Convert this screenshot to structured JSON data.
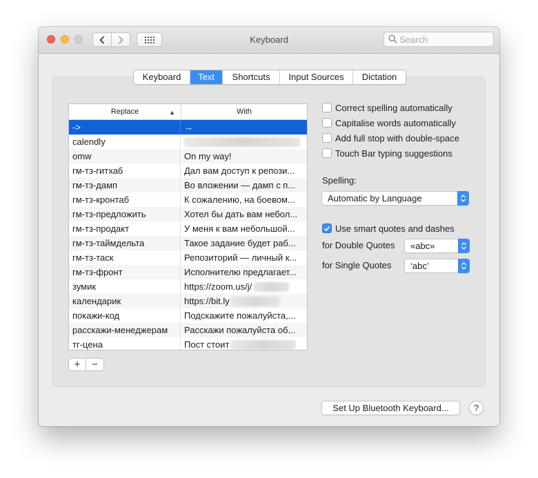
{
  "window": {
    "title": "Keyboard"
  },
  "search": {
    "placeholder": "Search"
  },
  "tabs": [
    {
      "label": "Keyboard",
      "active": false
    },
    {
      "label": "Text",
      "active": true
    },
    {
      "label": "Shortcuts",
      "active": false
    },
    {
      "label": "Input Sources",
      "active": false
    },
    {
      "label": "Dictation",
      "active": false
    }
  ],
  "table": {
    "headers": {
      "replace": "Replace",
      "with": "With"
    },
    "sort": "ascending",
    "rows": [
      {
        "replace": "->",
        "with": "→",
        "selected": true
      },
      {
        "replace": "calendly",
        "with": ""
      },
      {
        "replace": "omw",
        "with": "On my way!"
      },
      {
        "replace": "гм-тз-гитхаб",
        "with": "Дал вам доступ к репози..."
      },
      {
        "replace": "гм-тз-дамп",
        "with": "Во вложении — дамп с п..."
      },
      {
        "replace": "гм-тз-кронтаб",
        "with": "К сожалению, на боевом..."
      },
      {
        "replace": "гм-тз-предложить",
        "with": "Хотел бы дать вам небол..."
      },
      {
        "replace": "гм-тз-продакт",
        "with": "У меня к вам небольшой..."
      },
      {
        "replace": "гм-тз-таймдельта",
        "with": "Такое задание будет раб..."
      },
      {
        "replace": "гм-тз-таск",
        "with": "Репозиторий — личный к..."
      },
      {
        "replace": "гм-тз-фронт",
        "with": "Исполнителю предлагает..."
      },
      {
        "replace": "зумик",
        "with": "https://zoom.us/j/"
      },
      {
        "replace": "календарик",
        "with": "https://bit.ly"
      },
      {
        "replace": "покажи-код",
        "with": "Подскажите пожалуйста,..."
      },
      {
        "replace": "расскажи-менеджерам",
        "with": "Расскажи пожалуйста об..."
      },
      {
        "replace": "тг-цена",
        "with": "Пост стоит"
      }
    ]
  },
  "controls": {
    "add_label": "+",
    "remove_label": "−"
  },
  "options": {
    "correct_spelling": {
      "label": "Correct spelling automatically",
      "checked": false
    },
    "capitalise_words": {
      "label": "Capitalise words automatically",
      "checked": false
    },
    "full_stop": {
      "label": "Add full stop with double-space",
      "checked": false
    },
    "touch_bar": {
      "label": "Touch Bar typing suggestions",
      "checked": false
    }
  },
  "spelling": {
    "label": "Spelling:",
    "value": "Automatic by Language"
  },
  "smart_quotes": {
    "label": "Use smart quotes and dashes",
    "checked": true,
    "double_label": "for Double Quotes",
    "double_value": "«abc»",
    "single_label": "for Single Quotes",
    "single_value": "‘abc’"
  },
  "footer": {
    "bluetooth_label": "Set Up Bluetooth Keyboard...",
    "help_label": "?"
  },
  "colors": {
    "accent": "#3c8cf5",
    "selection": "#0f63d6"
  }
}
